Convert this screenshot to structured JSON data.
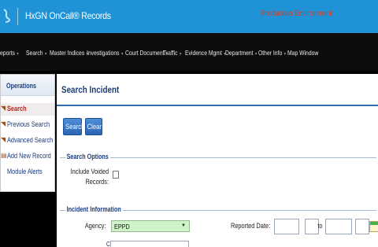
{
  "header": {
    "app_title": "HxGN OnCall® Records",
    "environment_label": "Production Environment"
  },
  "nav": {
    "items": [
      {
        "label": "eports"
      },
      {
        "label": "Search"
      },
      {
        "label": "Master Indices"
      },
      {
        "label": "Investigations"
      },
      {
        "label": "Court Document"
      },
      {
        "label": "Traffic"
      },
      {
        "label": "Evidence Mgmt"
      },
      {
        "label": "Department"
      },
      {
        "label": "Other Info"
      },
      {
        "label": "Map Window"
      }
    ]
  },
  "sidebar": {
    "heading": "Operations",
    "items": [
      {
        "label": "Search",
        "active": true
      },
      {
        "label": "Previous Search"
      },
      {
        "label": "Advanced Search"
      },
      {
        "label": "Add New Record"
      },
      {
        "label": "Module Alerts"
      }
    ]
  },
  "main": {
    "title": "Search Incident",
    "search_button": "Search",
    "clear_button": "Clear",
    "search_options": {
      "legend": "Search Options",
      "include_voided_label_1": "Include Voided",
      "include_voided_label_2": "Records:",
      "include_voided_checked": false
    },
    "incident_information": {
      "legend": "Incident Information",
      "agency_label": "Agency:",
      "agency_value": "EPPD",
      "reported_date_label": "Reported Date:",
      "to_label": "to",
      "next_label": "C"
    }
  },
  "colors": {
    "titlebar": "#1f93d6",
    "environment_text": "#e03a1c",
    "navbar": "#0d0d0d",
    "accent_blue": "#2f6db3",
    "agency_select_bg": "#cff3c9",
    "active_item_text": "#b3261e"
  },
  "icons": {
    "logo": "hxgn-logo-icon",
    "sidebar_item": "record-icon",
    "calendar": "calendar-icon",
    "dropdown": "chevron-down-icon"
  }
}
